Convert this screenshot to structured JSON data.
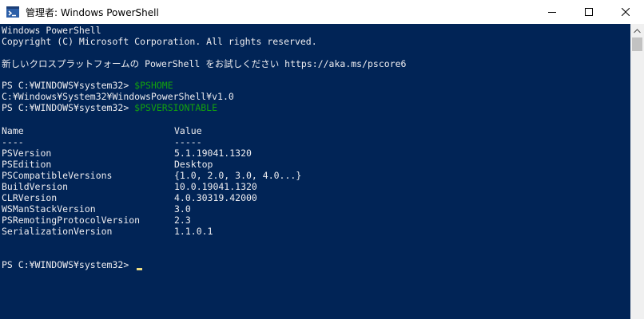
{
  "window": {
    "title": "管理者: Windows PowerShell"
  },
  "console": {
    "banner_line1": "Windows PowerShell",
    "banner_line2": "Copyright (C) Microsoft Corporation. All rights reserved.",
    "banner_line3": "新しいクロスプラットフォームの PowerShell をお試しください https://aka.ms/pscore6",
    "prompt": "PS C:¥WINDOWS¥system32> ",
    "command1": "$PSHOME",
    "output1": "C:¥Windows¥System32¥WindowsPowerShell¥v1.0",
    "command2": "$PSVERSIONTABLE",
    "table_headers": {
      "name": "Name",
      "value": "Value"
    },
    "table_separators": {
      "name": "----",
      "value": "-----"
    },
    "table_rows": [
      {
        "name": "PSVersion",
        "value": "5.1.19041.1320"
      },
      {
        "name": "PSEdition",
        "value": "Desktop"
      },
      {
        "name": "PSCompatibleVersions",
        "value": "{1.0, 2.0, 3.0, 4.0...}"
      },
      {
        "name": "BuildVersion",
        "value": "10.0.19041.1320"
      },
      {
        "name": "CLRVersion",
        "value": "4.0.30319.42000"
      },
      {
        "name": "WSManStackVersion",
        "value": "3.0"
      },
      {
        "name": "PSRemotingProtocolVersion",
        "value": "2.3"
      },
      {
        "name": "SerializationVersion",
        "value": "1.1.0.1"
      }
    ]
  },
  "colors": {
    "console_background": "#012456",
    "console_text": "#eeedf0",
    "command_text": "#13a10e",
    "cursor": "#eedc82"
  },
  "icons": {
    "app": "powershell-icon",
    "minimize": "minimize-icon",
    "maximize": "maximize-icon",
    "close": "close-icon",
    "scroll_up": "chevron-up-icon"
  }
}
